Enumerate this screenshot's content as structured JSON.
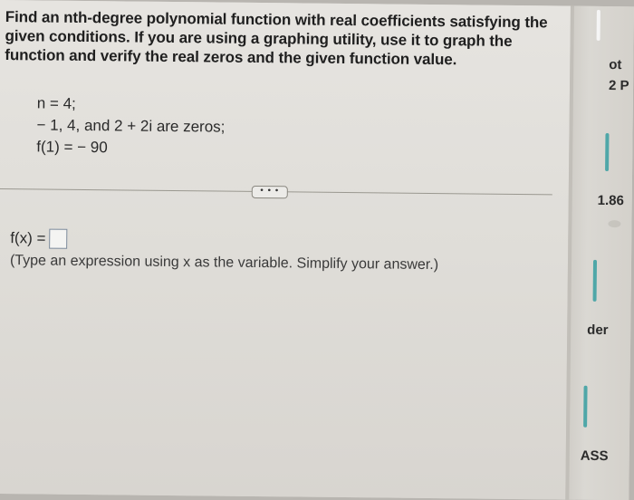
{
  "question": {
    "instructions_line1": "Find an nth-degree polynomial function with real coefficients satisfying the",
    "instructions_line2": "given conditions. If you are using a graphing utility, use it to graph the",
    "instructions_line3": "function and verify the real zeros and the given function value.",
    "condition_n": "n = 4;",
    "condition_zeros": "− 1, 4, and 2 + 2i are zeros;",
    "condition_value": "f(1) = − 90"
  },
  "expand_button_label": "• • •",
  "answer": {
    "prefix": "f(x) =",
    "value": "",
    "hint": "(Type an expression using x as the variable. Simplify your answer.)"
  },
  "sidebar": {
    "text_ot": "ot",
    "text_2p": "2 P",
    "text_score": "1.86",
    "text_der": "der",
    "text_ass": "ASS"
  }
}
